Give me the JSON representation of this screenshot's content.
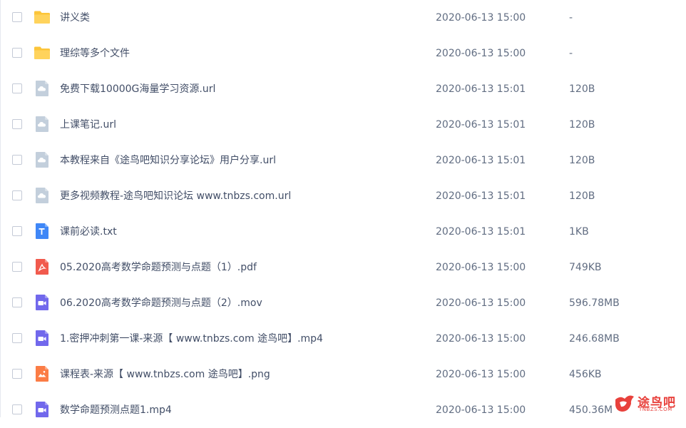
{
  "files": [
    {
      "name": "讲义类",
      "date": "2020-06-13 15:00",
      "size": "-",
      "icon": "folder-icon"
    },
    {
      "name": "理综等多个文件",
      "date": "2020-06-13 15:00",
      "size": "-",
      "icon": "folder-icon"
    },
    {
      "name": "免费下载10000G海量学习资源.url",
      "date": "2020-06-13 15:01",
      "size": "120B",
      "icon": "link-file-icon"
    },
    {
      "name": "上课笔记.url",
      "date": "2020-06-13 15:01",
      "size": "120B",
      "icon": "link-file-icon"
    },
    {
      "name": "本教程来自《途鸟吧知识分享论坛》用户分享.url",
      "date": "2020-06-13 15:01",
      "size": "120B",
      "icon": "link-file-icon"
    },
    {
      "name": "更多视频教程-途鸟吧知识论坛 www.tnbzs.com.url",
      "date": "2020-06-13 15:01",
      "size": "120B",
      "icon": "link-file-icon"
    },
    {
      "name": "课前必读.txt",
      "date": "2020-06-13 15:01",
      "size": "1KB",
      "icon": "text-file-icon"
    },
    {
      "name": "05.2020高考数学命题预测与点题（1）.pdf",
      "date": "2020-06-13 15:00",
      "size": "749KB",
      "icon": "pdf-file-icon"
    },
    {
      "name": "06.2020高考数学命题预测与点题（2）.mov",
      "date": "2020-06-13 15:00",
      "size": "596.78MB",
      "icon": "video-file-icon"
    },
    {
      "name": "1.密押冲刺第一课-来源【 www.tnbzs.com 途鸟吧】.mp4",
      "date": "2020-06-13 15:00",
      "size": "246.68MB",
      "icon": "video-file-icon"
    },
    {
      "name": "课程表-来源【 www.tnbzs.com 途鸟吧】.png",
      "date": "2020-06-13 15:00",
      "size": "456KB",
      "icon": "image-file-icon"
    },
    {
      "name": "数学命题预测点题1.mp4",
      "date": "2020-06-13 15:00",
      "size": "450.36M",
      "icon": "video-file-icon"
    }
  ],
  "watermark": {
    "text": "途鸟吧",
    "sub": "TNBZS.COM"
  },
  "colors": {
    "folder": "#fcc53a",
    "link": "#c3cfdc",
    "text": "#3f87f7",
    "pdf": "#f15a4d",
    "video": "#7168ec",
    "image": "#fb7c45",
    "watermark": "#e8413c"
  }
}
